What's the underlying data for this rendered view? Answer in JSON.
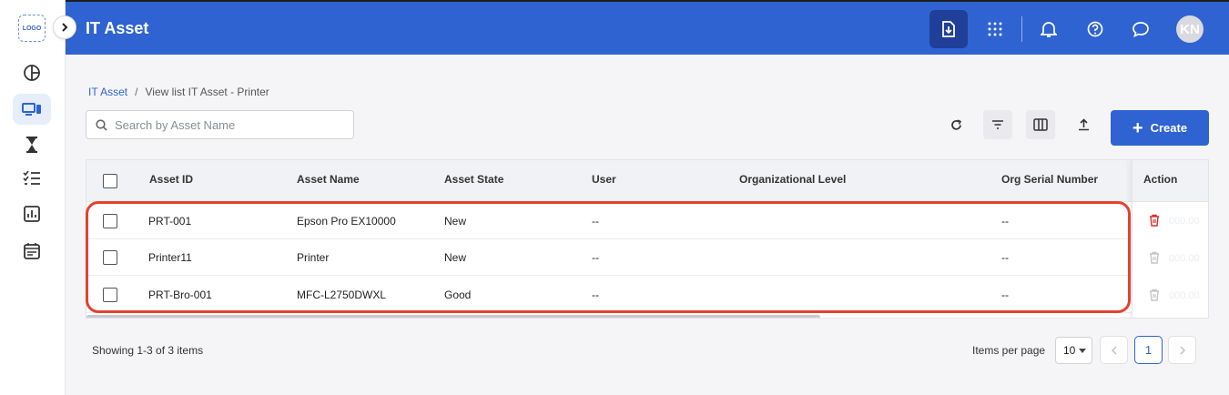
{
  "sidebar": {
    "logo_text": "LOGO",
    "items": [
      {
        "icon": "pie-chart-icon"
      },
      {
        "icon": "devices-icon",
        "active": true
      },
      {
        "icon": "hourglass-icon"
      },
      {
        "icon": "checklist-icon"
      },
      {
        "icon": "bar-chart-icon"
      },
      {
        "icon": "calendar-icon"
      }
    ]
  },
  "header": {
    "title": "IT Asset",
    "avatar_initials": "KN",
    "icons": [
      "download-icon",
      "apps-grid-icon",
      "bell-icon",
      "help-icon",
      "chat-icon"
    ]
  },
  "breadcrumb": {
    "root": "IT Asset",
    "separator": "/",
    "current": "View list IT Asset - Printer"
  },
  "search": {
    "placeholder": "Search by Asset Name",
    "value": ""
  },
  "toolbar": {
    "create_label": "Create",
    "icons": [
      "refresh-icon",
      "filter-icon",
      "columns-icon",
      "export-icon"
    ]
  },
  "table": {
    "columns": [
      "Asset ID",
      "Asset Name",
      "Asset State",
      "User",
      "Organizational Level",
      "Org Serial Number"
    ],
    "action_header": "Action",
    "rows": [
      {
        "asset_id": "PRT-001",
        "asset_name": "Epson Pro EX10000",
        "state": "New",
        "user": "--",
        "org_level": "",
        "org_serial": "--",
        "delete_enabled": true
      },
      {
        "asset_id": "Printer11",
        "asset_name": "Printer",
        "state": "New",
        "user": "--",
        "org_level": "",
        "org_serial": "--",
        "delete_enabled": false
      },
      {
        "asset_id": "PRT-Bro-001",
        "asset_name": "MFC-L2750DWXL",
        "state": "Good",
        "user": "--",
        "org_level": "",
        "org_serial": "--",
        "delete_enabled": false
      }
    ],
    "hidden_cell_text": "000.00"
  },
  "footer": {
    "showing": "Showing 1-3 of 3 items",
    "items_per_page_label": "Items per page",
    "items_per_page_value": "10",
    "current_page": "1"
  },
  "colors": {
    "primary": "#2f63d1",
    "header_active": "#1f3f99",
    "highlight": "#e5412c",
    "delete": "#d9342b"
  }
}
